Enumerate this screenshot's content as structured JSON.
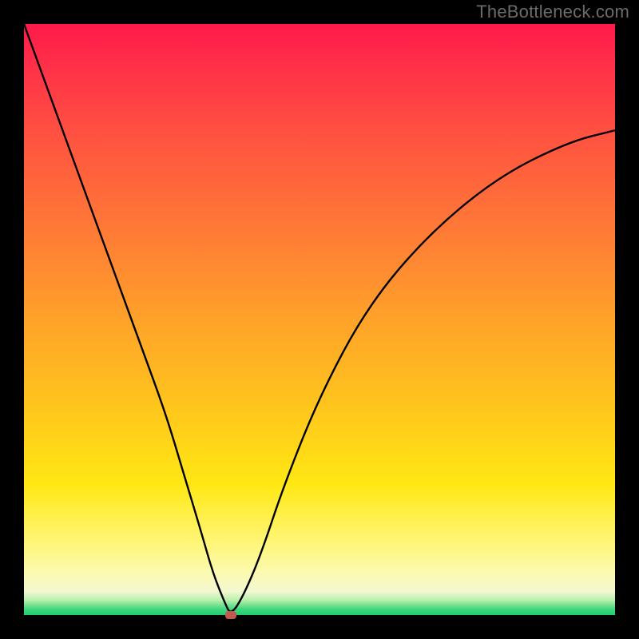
{
  "watermark": {
    "text": "TheBottleneck.com"
  },
  "chart_data": {
    "type": "line",
    "title": "",
    "xlabel": "",
    "ylabel": "",
    "xlim": [
      0,
      100
    ],
    "ylim": [
      0,
      100
    ],
    "grid": false,
    "legend": false,
    "background": {
      "kind": "vertical_gradient",
      "stops": [
        {
          "pos": 0,
          "color": "#ff1a4b"
        },
        {
          "pos": 0.35,
          "color": "#ff7a36"
        },
        {
          "pos": 0.65,
          "color": "#ffc61c"
        },
        {
          "pos": 0.88,
          "color": "#fff67a"
        },
        {
          "pos": 0.97,
          "color": "#b6f0ac"
        },
        {
          "pos": 1.0,
          "color": "#1ecf72"
        }
      ]
    },
    "series": [
      {
        "name": "bottleneck-curve",
        "color": "#000000",
        "x": [
          0,
          4,
          8,
          12,
          16,
          20,
          24,
          27,
          30,
          32,
          34,
          35,
          37,
          40,
          44,
          50,
          58,
          68,
          80,
          92,
          100
        ],
        "y": [
          100,
          89,
          78,
          67,
          56,
          45,
          34,
          24,
          14,
          7,
          2,
          0,
          3,
          10,
          22,
          37,
          52,
          64,
          74,
          80,
          82
        ]
      }
    ],
    "markers": [
      {
        "name": "min-point",
        "shape": "rounded-rect",
        "x": 35,
        "y": 0,
        "color": "#c05a50"
      }
    ]
  }
}
